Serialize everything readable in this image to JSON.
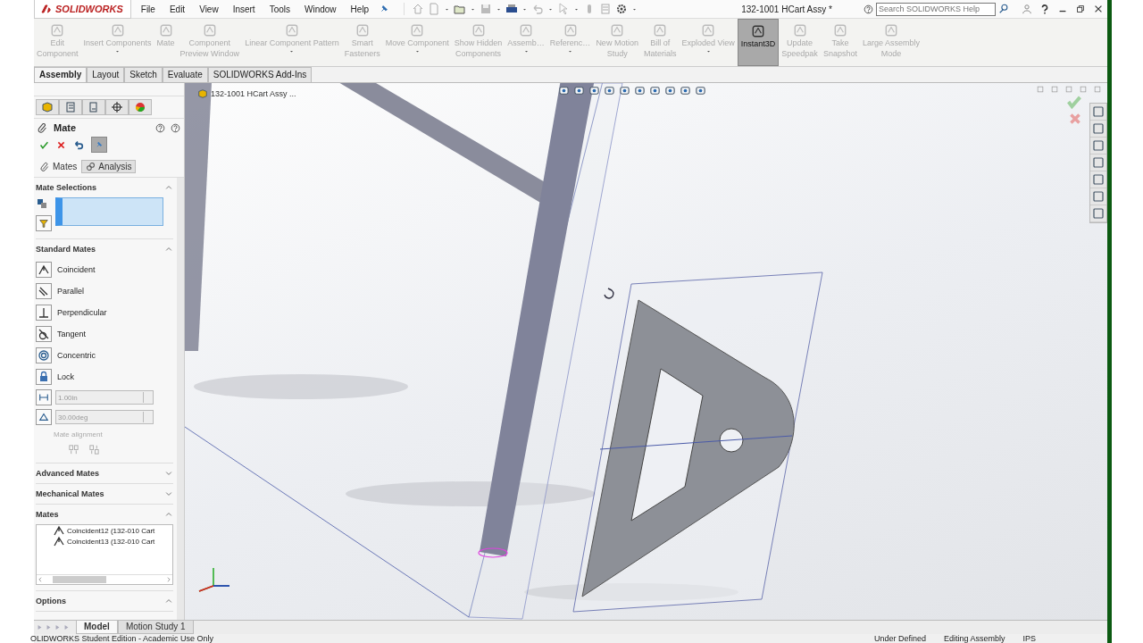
{
  "title_bar": {
    "logo": "SOLIDWORKS",
    "menus": [
      "File",
      "Edit",
      "View",
      "Insert",
      "Tools",
      "Window",
      "Help"
    ],
    "document_title": "132-1001 HCart Assy *",
    "search": {
      "placeholder": "Search SOLIDWORKS Help"
    }
  },
  "toolbar": {
    "buttons": [
      {
        "label": "Edit\nComponent",
        "disabled": true,
        "dropdown": false,
        "selected": false
      },
      {
        "label": "Insert Components",
        "disabled": true,
        "dropdown": true,
        "selected": false
      },
      {
        "label": "Mate",
        "disabled": true,
        "dropdown": false,
        "selected": false
      },
      {
        "label": "Component\nPreview Window",
        "disabled": true,
        "dropdown": false,
        "selected": false
      },
      {
        "label": "Linear Component Pattern",
        "disabled": true,
        "dropdown": true,
        "selected": false
      },
      {
        "label": "Smart\nFasteners",
        "disabled": true,
        "dropdown": false,
        "selected": false
      },
      {
        "label": "Move Component",
        "disabled": true,
        "dropdown": true,
        "selected": false
      },
      {
        "label": "Show Hidden\nComponents",
        "disabled": true,
        "dropdown": false,
        "selected": false
      },
      {
        "label": "Assemb…",
        "disabled": true,
        "dropdown": true,
        "selected": false
      },
      {
        "label": "Referenc…",
        "disabled": true,
        "dropdown": true,
        "selected": false
      },
      {
        "label": "New Motion\nStudy",
        "disabled": true,
        "dropdown": false,
        "selected": false
      },
      {
        "label": "Bill of\nMaterials",
        "disabled": true,
        "dropdown": false,
        "selected": false
      },
      {
        "label": "Exploded View",
        "disabled": true,
        "dropdown": true,
        "selected": false
      },
      {
        "label": "Instant3D",
        "disabled": false,
        "dropdown": false,
        "selected": true
      },
      {
        "label": "Update\nSpeedpak",
        "disabled": true,
        "dropdown": false,
        "selected": false
      },
      {
        "label": "Take\nSnapshot",
        "disabled": true,
        "dropdown": false,
        "selected": false
      },
      {
        "label": "Large Assembly\nMode",
        "disabled": true,
        "dropdown": false,
        "selected": false
      }
    ]
  },
  "tabs": [
    {
      "label": "Assembly",
      "selected": true
    },
    {
      "label": "Layout",
      "selected": false
    },
    {
      "label": "Sketch",
      "selected": false
    },
    {
      "label": "Evaluate",
      "selected": false
    },
    {
      "label": "SOLIDWORKS Add-Ins",
      "selected": false
    }
  ],
  "property_manager": {
    "title": "Mate",
    "subtabs": [
      {
        "label": "Mates",
        "selected": true
      },
      {
        "label": "Analysis",
        "selected": false
      }
    ],
    "sections": [
      {
        "kind": "selections",
        "title": "Mate Selections",
        "expanded": true
      },
      {
        "kind": "standard",
        "title": "Standard Mates",
        "expanded": true,
        "mates": [
          "Coincident",
          "Parallel",
          "Perpendicular",
          "Tangent",
          "Concentric",
          "Lock"
        ],
        "distance": {
          "value": "1.00in",
          "disabled": true
        },
        "angle": {
          "value": "30.00deg",
          "disabled": true
        },
        "alignment_label": "Mate alignment"
      },
      {
        "kind": "plain",
        "title": "Advanced Mates",
        "expanded": false
      },
      {
        "kind": "plain",
        "title": "Mechanical Mates",
        "expanded": false
      },
      {
        "kind": "list",
        "title": "Mates",
        "expanded": true,
        "items": [
          "Coincident12 (132-010 Cart",
          "Coincident13 (132-010 Cart"
        ]
      },
      {
        "kind": "plain",
        "title": "Options",
        "expanded": true
      }
    ]
  },
  "graphics": {
    "tree_label": "132-1001 HCart Assy ..."
  },
  "bottom_tabs": [
    {
      "label": "Model",
      "selected": true
    },
    {
      "label": "Motion Study 1",
      "selected": false
    }
  ],
  "status_bar": {
    "edition": "OLIDWORKS Student Edition - Academic Use Only",
    "state": "Under Defined",
    "mode": "Editing Assembly",
    "units": "IPS"
  }
}
